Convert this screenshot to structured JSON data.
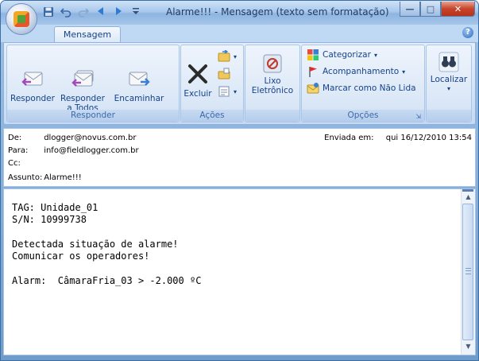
{
  "window": {
    "title": "Alarme!!! - Mensagem (texto sem formatação)",
    "minimize": "—",
    "maximize": "□",
    "close": "✕"
  },
  "tabs": [
    {
      "label": "Mensagem"
    }
  ],
  "help": "?",
  "ribbon": {
    "groups": {
      "responder": {
        "label": "Responder",
        "buttons": {
          "reply": "Responder",
          "reply_all": "Responder a Todos",
          "forward": "Encaminhar"
        }
      },
      "acoes": {
        "label": "Ações",
        "buttons": {
          "delete": "Excluir"
        }
      },
      "junk": {
        "label": "",
        "buttons": {
          "junk": "Lixo Eletrônico"
        }
      },
      "opcoes": {
        "label": "Opções",
        "buttons": {
          "categorize": "Categorizar",
          "followup": "Acompanhamento",
          "mark_unread": "Marcar como Não Lida"
        }
      },
      "find": {
        "label": "",
        "buttons": {
          "find": "Localizar"
        }
      }
    }
  },
  "header": {
    "from_label": "De:",
    "from": "dlogger@novus.com.br",
    "to_label": "Para:",
    "to": "info@fieldlogger.com.br",
    "cc_label": "Cc:",
    "cc": "",
    "subject_label": "Assunto:",
    "subject": "Alarme!!!",
    "sent_label": "Enviada em:",
    "sent": "qui 16/12/2010 13:54"
  },
  "body": {
    "text": "TAG: Unidade_01\nS/N: 10999738\n\nDetectada situação de alarme!\nComunicar os operadores!\n\nAlarm:  CâmaraFria_03 > -2.000 ºC"
  },
  "colors": {
    "accent": "#15428b",
    "titlebar": "#a9c8ec",
    "ribbon": "#d3e3f6",
    "close": "#c7442b"
  }
}
